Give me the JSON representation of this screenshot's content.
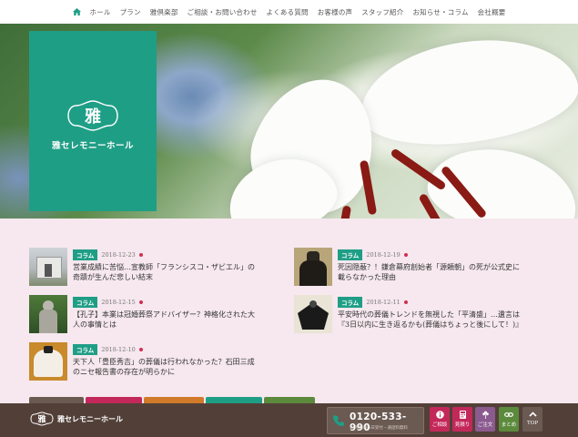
{
  "nav": {
    "items": [
      "ホール",
      "プラン",
      "雅倶楽部",
      "ご相談・お問い合わせ",
      "よくある質問",
      "お客様の声",
      "スタッフ紹介",
      "お知らせ・コラム",
      "会社概要"
    ]
  },
  "brand": {
    "name": "雅セレモニーホール",
    "emblem_char": "雅",
    "color": "#1f9e86"
  },
  "news_left": [
    {
      "category": "コラム",
      "date": "2018-12-23",
      "title": "営業成績に苦悩…宣教師「フランシスコ・ザビエル」の奇蹟が生んだ悲しい結末"
    },
    {
      "category": "コラム",
      "date": "2018-12-15",
      "title": "【孔子】本業は冠婚葬祭アドバイザー？神格化された大人の事情とは"
    },
    {
      "category": "コラム",
      "date": "2018-12-10",
      "title": "天下人「豊臣秀吉」の葬儀は行われなかった？石田三成のニセ報告書の存在が明らかに"
    }
  ],
  "news_right": [
    {
      "category": "コラム",
      "date": "2018-12-19",
      "title": "死因隠蔽？！鎌倉幕府創始者「源頼朝」の死が公式史に載らなかった理由"
    },
    {
      "category": "コラム",
      "date": "2018-12-11",
      "title": "平安時代の葬儀トレンドを無視した「平清盛」…遺言は『3日以内に生き返るかも(葬儀はちょっと後にして！)』"
    }
  ],
  "footer": {
    "logo_text": "雅セレモニーホール",
    "phone": "0120-533-990",
    "phone_note": "24時間365日受付・通話料無料",
    "buttons": [
      {
        "label": "ご相談",
        "color": "#c3285a",
        "icon": "info-icon"
      },
      {
        "label": "見積り",
        "color": "#c3285a",
        "icon": "calculator-icon"
      },
      {
        "label": "ご注文",
        "color": "#8b5a8f",
        "icon": "flower-icon"
      },
      {
        "label": "まとめ",
        "color": "#5c8a3c",
        "icon": "link-icon"
      },
      {
        "label": "TOP",
        "color": "#6a5a52",
        "icon": "arrow-up-icon"
      }
    ]
  },
  "tabs": [
    {
      "color": "#6a5a52"
    },
    {
      "color": "#c3285a"
    },
    {
      "color": "#d07a2a"
    },
    {
      "color": "#1f9e86"
    },
    {
      "color": "#5c8a3c"
    }
  ]
}
